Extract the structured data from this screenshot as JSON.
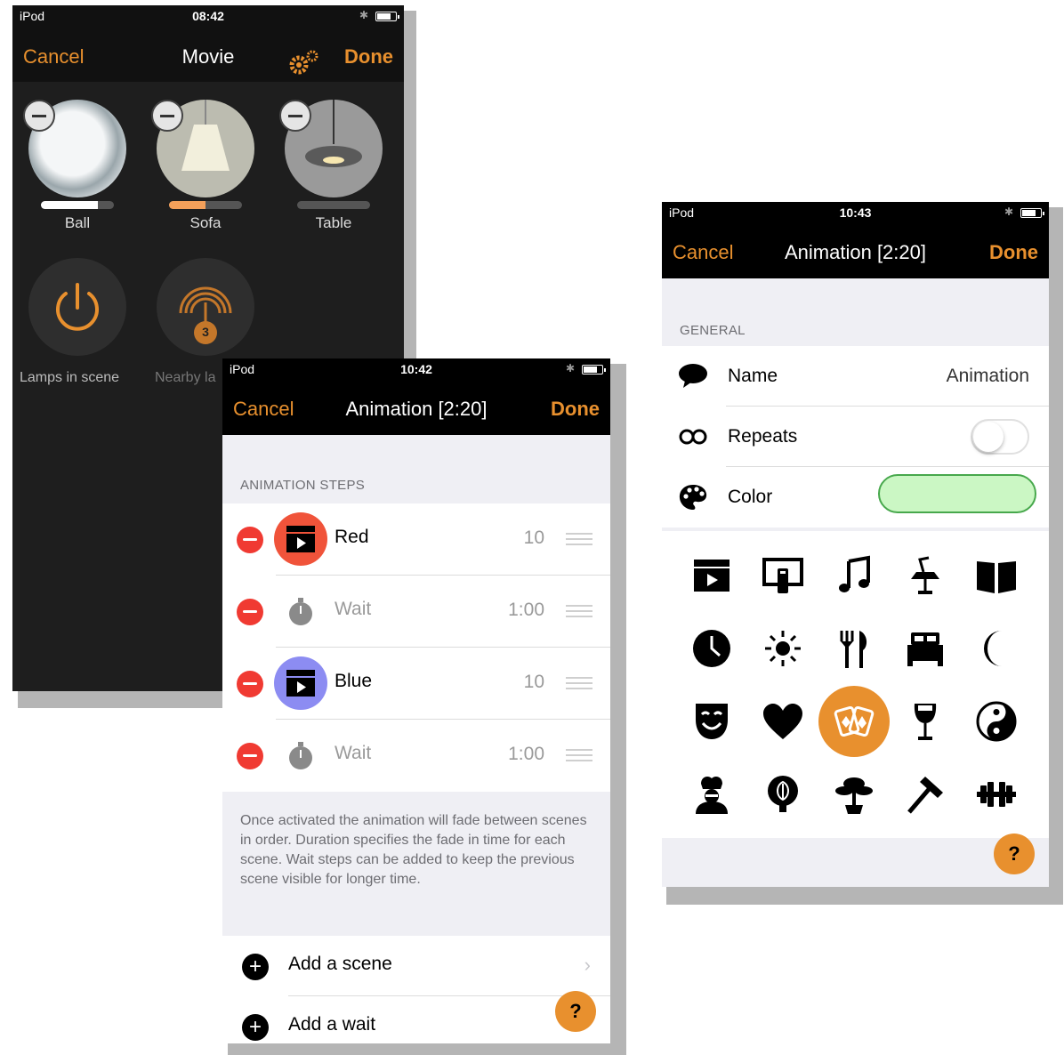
{
  "phone_movie": {
    "status": {
      "carrier": "iPod",
      "time": "08:42"
    },
    "nav": {
      "cancel": "Cancel",
      "title": "Movie",
      "done": "Done"
    },
    "lamps": [
      {
        "name": "Ball",
        "level": 0.78,
        "bar_color": "#ffffff"
      },
      {
        "name": "Sofa",
        "level": 0.5,
        "bar_color": "#f4a05a"
      },
      {
        "name": "Table",
        "level": 0.0,
        "bar_color": "#888888"
      }
    ],
    "actions": {
      "lamps_in_scene": "Lamps in scene",
      "nearby": "Nearby la",
      "nearby_badge": "3"
    }
  },
  "phone_steps": {
    "status": {
      "carrier": "iPod",
      "time": "10:42"
    },
    "nav": {
      "cancel": "Cancel",
      "title": "Animation [2:20]",
      "done": "Done"
    },
    "section_header": "ANIMATION STEPS",
    "steps": [
      {
        "name": "Red",
        "value": "10",
        "kind": "scene",
        "color": "#f0533a"
      },
      {
        "name": "Wait",
        "value": "1:00",
        "kind": "wait"
      },
      {
        "name": "Blue",
        "value": "10",
        "kind": "scene",
        "color": "#8c8cf2"
      },
      {
        "name": "Wait",
        "value": "1:00",
        "kind": "wait"
      }
    ],
    "footer": "Once activated the animation will fade between scenes in order. Duration specifies the fade in time for each scene. Wait steps can be added to keep the previous scene visible for longer time.",
    "add_scene": "Add a scene",
    "add_wait": "Add a wait",
    "help": "?"
  },
  "phone_general": {
    "status": {
      "carrier": "iPod",
      "time": "10:43"
    },
    "nav": {
      "cancel": "Cancel",
      "title": "Animation [2:20]",
      "done": "Done"
    },
    "section_header": "GENERAL",
    "name_label": "Name",
    "name_value": "Animation",
    "repeats_label": "Repeats",
    "repeats_on": false,
    "color_label": "Color",
    "color_value": "#cbf7c4",
    "icons": [
      "clapperboard-icon",
      "tv-remote-icon",
      "music-note-icon",
      "lamp-icon",
      "book-icon",
      "clock-icon",
      "sun-icon",
      "fork-knife-icon",
      "bed-icon",
      "moon-icon",
      "theater-mask-icon",
      "heart-icon",
      "cards-icon",
      "wine-glass-icon",
      "yin-yang-icon",
      "chef-icon",
      "tree-icon",
      "bonsai-icon",
      "hammer-icon",
      "dumbbell-icon"
    ],
    "selected_icon": "cards-icon",
    "help": "?"
  },
  "colors": {
    "accent": "#e8902e",
    "delete": "#f03a32"
  }
}
